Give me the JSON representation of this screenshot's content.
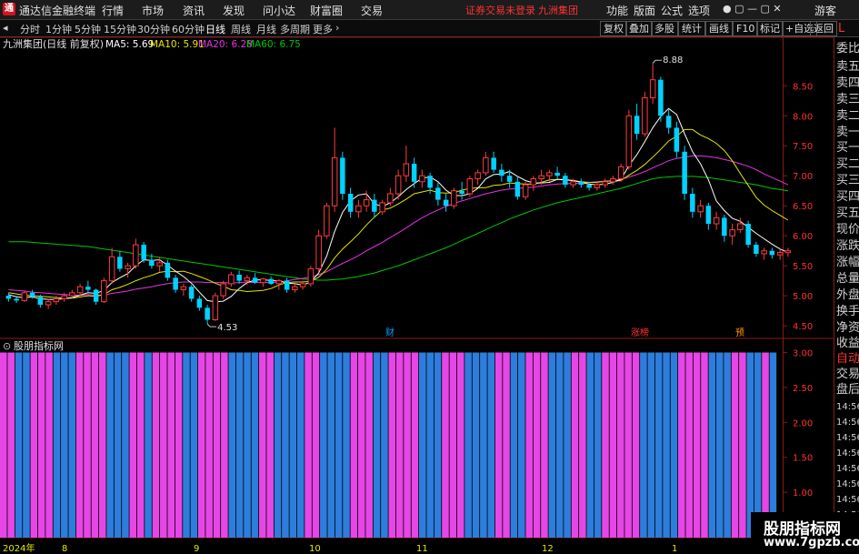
{
  "app": {
    "title": "通达信金融终端",
    "menu": [
      "行情",
      "市场",
      "资讯",
      "发现",
      "问小达",
      "财富圈",
      "交易"
    ],
    "notice": "证券交易未登录",
    "stock_name": "九洲集团",
    "right_menu": [
      "功能",
      "版面",
      "公式",
      "选项"
    ],
    "user": "游客"
  },
  "toolbar": {
    "periods": [
      "分时",
      "1分钟",
      "5分钟",
      "15分钟",
      "30分钟",
      "60分钟",
      "日线",
      "周线",
      "月线",
      "多周期",
      "更多"
    ],
    "active_period": "日线",
    "buttons": [
      "复权",
      "叠加",
      "多股",
      "统计",
      "画线",
      "F10",
      "标记",
      "+自选",
      "返回"
    ]
  },
  "chart_header": {
    "title": "九洲集团(日线 前复权)",
    "ma5": "MA5: 5.69",
    "ma10": "MA10: 5.91",
    "ma20": "MA20: 6.28",
    "ma60": "MA60: 6.75"
  },
  "colors": {
    "up": "#ff3c3c",
    "down": "#00d2ff",
    "ma5": "#ffffff",
    "ma10": "#e6e600",
    "ma20": "#e632e6",
    "ma60": "#00c800",
    "ind_a": "#e646e6",
    "ind_b": "#2d7ddc"
  },
  "price_axis": {
    "labels": [
      "8.50",
      "8.00",
      "7.50",
      "7.00",
      "6.50",
      "6.00",
      "5.50",
      "5.00",
      "4.50"
    ],
    "max_label": "8.88",
    "min_label": "4.53"
  },
  "event_markers": [
    "财",
    "涨榜",
    "预"
  ],
  "indicator": {
    "title": "股朋指标网",
    "axis_labels": [
      "3.00",
      "2.50",
      "2.00",
      "1.50",
      "1.00",
      "0.50"
    ]
  },
  "time_axis": [
    "2024年",
    "8",
    "9",
    "10",
    "11",
    "12",
    "1"
  ],
  "sidebar": {
    "labels": [
      "委比",
      "卖五",
      "卖四",
      "卖三",
      "卖二",
      "卖一",
      "买一",
      "买二",
      "买三",
      "买四",
      "买五",
      "现价",
      "涨跌",
      "涨幅",
      "总量",
      "外盘",
      "换手",
      "净资",
      "收益",
      "自动",
      "交易",
      "盘后"
    ],
    "times": [
      "14:56",
      "14:56",
      "14:56",
      "14:56",
      "14:56",
      "14:56",
      "14:56",
      "14:56"
    ],
    "corner": "L"
  },
  "watermark": {
    "line1": "股朋指标网",
    "line2": "www.7gpzb.com"
  },
  "chart_data": {
    "type": "candlestick",
    "ohlc": [
      [
        5.0,
        5.05,
        4.9,
        4.95
      ],
      [
        4.95,
        5.0,
        4.88,
        4.92
      ],
      [
        4.92,
        5.08,
        4.9,
        5.05
      ],
      [
        5.05,
        5.1,
        4.95,
        4.98
      ],
      [
        4.98,
        5.02,
        4.8,
        4.85
      ],
      [
        4.85,
        4.95,
        4.78,
        4.9
      ],
      [
        4.9,
        5.0,
        4.85,
        4.95
      ],
      [
        4.95,
        5.05,
        4.9,
        5.0
      ],
      [
        5.0,
        5.1,
        4.95,
        5.05
      ],
      [
        5.05,
        5.2,
        5.0,
        5.15
      ],
      [
        5.15,
        5.25,
        5.05,
        5.1
      ],
      [
        5.1,
        5.12,
        4.85,
        4.9
      ],
      [
        4.9,
        5.3,
        4.88,
        5.25
      ],
      [
        5.25,
        5.8,
        5.2,
        5.65
      ],
      [
        5.65,
        5.75,
        5.4,
        5.45
      ],
      [
        5.45,
        5.55,
        5.3,
        5.5
      ],
      [
        5.5,
        5.95,
        5.45,
        5.85
      ],
      [
        5.85,
        5.9,
        5.55,
        5.6
      ],
      [
        5.6,
        5.7,
        5.45,
        5.5
      ],
      [
        5.5,
        5.65,
        5.4,
        5.55
      ],
      [
        5.55,
        5.6,
        5.25,
        5.3
      ],
      [
        5.3,
        5.35,
        5.05,
        5.1
      ],
      [
        5.1,
        5.2,
        5.0,
        5.15
      ],
      [
        5.15,
        5.18,
        4.9,
        4.95
      ],
      [
        4.95,
        5.0,
        4.75,
        4.8
      ],
      [
        4.8,
        4.85,
        4.53,
        4.6
      ],
      [
        4.6,
        5.05,
        4.58,
        5.0
      ],
      [
        5.0,
        5.25,
        4.95,
        5.2
      ],
      [
        5.2,
        5.4,
        5.15,
        5.35
      ],
      [
        5.35,
        5.42,
        5.2,
        5.25
      ],
      [
        5.25,
        5.35,
        5.18,
        5.3
      ],
      [
        5.3,
        5.38,
        5.2,
        5.22
      ],
      [
        5.22,
        5.3,
        5.15,
        5.28
      ],
      [
        5.28,
        5.32,
        5.18,
        5.2
      ],
      [
        5.2,
        5.28,
        5.1,
        5.25
      ],
      [
        5.25,
        5.3,
        5.05,
        5.1
      ],
      [
        5.1,
        5.2,
        5.05,
        5.15
      ],
      [
        5.15,
        5.25,
        5.1,
        5.2
      ],
      [
        5.2,
        5.5,
        5.15,
        5.45
      ],
      [
        5.45,
        6.1,
        5.4,
        6.0
      ],
      [
        6.0,
        6.55,
        5.95,
        6.5
      ],
      [
        6.5,
        7.8,
        6.4,
        7.3
      ],
      [
        7.3,
        7.4,
        6.6,
        6.7
      ],
      [
        6.7,
        6.8,
        6.3,
        6.4
      ],
      [
        6.4,
        6.6,
        6.3,
        6.5
      ],
      [
        6.5,
        6.75,
        6.4,
        6.6
      ],
      [
        6.6,
        6.7,
        6.3,
        6.4
      ],
      [
        6.4,
        6.6,
        6.35,
        6.55
      ],
      [
        6.55,
        6.8,
        6.5,
        6.7
      ],
      [
        6.7,
        7.1,
        6.6,
        7.0
      ],
      [
        7.0,
        7.5,
        6.9,
        7.2
      ],
      [
        7.2,
        7.3,
        6.8,
        6.9
      ],
      [
        6.9,
        7.1,
        6.8,
        7.0
      ],
      [
        7.0,
        7.05,
        6.7,
        6.8
      ],
      [
        6.8,
        6.9,
        6.5,
        6.6
      ],
      [
        6.6,
        6.7,
        6.4,
        6.5
      ],
      [
        6.5,
        6.8,
        6.45,
        6.75
      ],
      [
        6.75,
        6.9,
        6.6,
        6.7
      ],
      [
        6.7,
        7.0,
        6.65,
        6.95
      ],
      [
        6.95,
        7.1,
        6.85,
        7.05
      ],
      [
        7.05,
        7.4,
        7.0,
        7.3
      ],
      [
        7.3,
        7.4,
        7.05,
        7.1
      ],
      [
        7.1,
        7.2,
        6.9,
        7.0
      ],
      [
        7.0,
        7.1,
        6.8,
        6.9
      ],
      [
        6.9,
        7.0,
        6.6,
        6.65
      ],
      [
        6.65,
        6.9,
        6.6,
        6.85
      ],
      [
        6.85,
        7.0,
        6.75,
        6.95
      ],
      [
        6.95,
        7.1,
        6.85,
        7.0
      ],
      [
        7.0,
        7.1,
        6.9,
        7.05
      ],
      [
        7.05,
        7.15,
        6.95,
        7.0
      ],
      [
        7.0,
        7.05,
        6.8,
        6.85
      ],
      [
        6.85,
        6.95,
        6.8,
        6.9
      ],
      [
        6.9,
        6.95,
        6.8,
        6.85
      ],
      [
        6.85,
        6.9,
        6.75,
        6.8
      ],
      [
        6.8,
        6.9,
        6.75,
        6.85
      ],
      [
        6.85,
        6.95,
        6.8,
        6.9
      ],
      [
        6.9,
        7.0,
        6.85,
        6.95
      ],
      [
        6.95,
        7.2,
        6.9,
        7.15
      ],
      [
        7.15,
        8.1,
        7.1,
        8.0
      ],
      [
        8.0,
        8.2,
        7.6,
        7.7
      ],
      [
        7.7,
        8.4,
        7.65,
        8.3
      ],
      [
        8.3,
        8.88,
        8.2,
        8.6
      ],
      [
        8.6,
        8.65,
        7.9,
        8.0
      ],
      [
        8.0,
        8.1,
        7.7,
        7.8
      ],
      [
        7.8,
        7.9,
        7.3,
        7.4
      ],
      [
        7.4,
        7.5,
        6.6,
        6.7
      ],
      [
        6.7,
        6.8,
        6.3,
        6.4
      ],
      [
        6.4,
        6.6,
        6.3,
        6.5
      ],
      [
        6.5,
        6.55,
        6.1,
        6.2
      ],
      [
        6.2,
        6.4,
        6.1,
        6.3
      ],
      [
        6.3,
        6.35,
        5.9,
        6.0
      ],
      [
        6.0,
        6.2,
        5.85,
        6.1
      ],
      [
        6.1,
        6.3,
        6.05,
        6.2
      ],
      [
        6.2,
        6.25,
        5.8,
        5.85
      ],
      [
        5.85,
        5.9,
        5.65,
        5.7
      ],
      [
        5.7,
        5.8,
        5.6,
        5.75
      ],
      [
        5.75,
        5.8,
        5.62,
        5.68
      ],
      [
        5.68,
        5.78,
        5.6,
        5.72
      ],
      [
        5.72,
        5.8,
        5.65,
        5.75
      ]
    ],
    "ma5": [
      5.02,
      4.98,
      4.97,
      4.98,
      4.95,
      4.94,
      4.94,
      4.95,
      4.97,
      5.01,
      5.05,
      5.04,
      5.09,
      5.22,
      5.3,
      5.37,
      5.5,
      5.6,
      5.59,
      5.6,
      5.51,
      5.41,
      5.32,
      5.21,
      5.06,
      4.92,
      4.9,
      4.91,
      4.99,
      5.12,
      5.22,
      5.26,
      5.27,
      5.25,
      5.25,
      5.21,
      5.2,
      5.18,
      5.23,
      5.38,
      5.66,
      6.07,
      6.39,
      6.58,
      6.68,
      6.7,
      6.53,
      6.49,
      6.55,
      6.65,
      6.77,
      6.87,
      6.96,
      6.98,
      6.9,
      6.76,
      6.67,
      6.67,
      6.7,
      6.79,
      6.95,
      7.02,
      7.03,
      7.07,
      6.99,
      6.92,
      6.88,
      6.88,
      6.89,
      6.94,
      6.93,
      6.92,
      6.89,
      6.86,
      6.85,
      6.86,
      6.89,
      6.94,
      7.17,
      7.35,
      7.57,
      7.8,
      7.99,
      8.12,
      8.02,
      7.7,
      7.4,
      7.2,
      6.93,
      6.58,
      6.42,
      6.29,
      6.24,
      6.14,
      6.04,
      5.95,
      5.86,
      5.78,
      5.72
    ],
    "ma10": [
      5.05,
      5.03,
      5.01,
      5.0,
      4.99,
      4.98,
      4.97,
      4.96,
      4.96,
      4.98,
      5.0,
      4.99,
      5.02,
      5.1,
      5.14,
      5.19,
      5.25,
      5.3,
      5.34,
      5.39,
      5.41,
      5.4,
      5.41,
      5.37,
      5.32,
      5.27,
      5.21,
      5.16,
      5.1,
      5.09,
      5.07,
      5.08,
      5.09,
      5.12,
      5.18,
      5.22,
      5.23,
      5.23,
      5.24,
      5.31,
      5.44,
      5.63,
      5.78,
      5.9,
      6.03,
      6.18,
      6.31,
      6.43,
      6.46,
      6.53,
      6.61,
      6.7,
      6.73,
      6.76,
      6.72,
      6.71,
      6.72,
      6.76,
      6.79,
      6.8,
      6.8,
      6.84,
      6.85,
      6.88,
      6.87,
      6.86,
      6.86,
      6.89,
      6.93,
      6.94,
      6.94,
      6.92,
      6.9,
      6.89,
      6.89,
      6.91,
      6.91,
      6.92,
      7.01,
      7.09,
      7.19,
      7.31,
      7.44,
      7.58,
      7.66,
      7.77,
      7.77,
      7.68,
      7.62,
      7.54,
      7.42,
      7.25,
      7.04,
      6.84,
      6.64,
      6.51,
      6.42,
      6.34,
      6.26
    ],
    "ma20": [
      5.1,
      5.09,
      5.08,
      5.06,
      5.05,
      5.04,
      5.03,
      5.02,
      5.01,
      5.01,
      5.02,
      5.01,
      5.01,
      5.04,
      5.06,
      5.08,
      5.11,
      5.13,
      5.15,
      5.18,
      5.2,
      5.22,
      5.23,
      5.23,
      5.23,
      5.22,
      5.22,
      5.22,
      5.21,
      5.22,
      5.23,
      5.22,
      5.22,
      5.22,
      5.23,
      5.25,
      5.27,
      5.29,
      5.31,
      5.35,
      5.4,
      5.47,
      5.54,
      5.6,
      5.67,
      5.75,
      5.82,
      5.89,
      5.97,
      6.05,
      6.13,
      6.22,
      6.3,
      6.37,
      6.43,
      6.49,
      6.54,
      6.58,
      6.62,
      6.66,
      6.7,
      6.73,
      6.76,
      6.78,
      6.79,
      6.8,
      6.81,
      6.83,
      6.85,
      6.86,
      6.87,
      6.87,
      6.88,
      6.89,
      6.9,
      6.91,
      6.92,
      6.94,
      6.98,
      7.02,
      7.07,
      7.13,
      7.19,
      7.25,
      7.29,
      7.31,
      7.33,
      7.33,
      7.32,
      7.3,
      7.27,
      7.24,
      7.2,
      7.16,
      7.1,
      7.03,
      6.97,
      6.91,
      6.85
    ],
    "ma60": [
      5.9,
      5.9,
      5.9,
      5.89,
      5.88,
      5.87,
      5.86,
      5.85,
      5.84,
      5.83,
      5.82,
      5.8,
      5.78,
      5.76,
      5.74,
      5.72,
      5.7,
      5.68,
      5.66,
      5.64,
      5.62,
      5.6,
      5.58,
      5.56,
      5.54,
      5.52,
      5.5,
      5.48,
      5.46,
      5.44,
      5.42,
      5.4,
      5.38,
      5.36,
      5.34,
      5.32,
      5.3,
      5.28,
      5.27,
      5.26,
      5.26,
      5.27,
      5.28,
      5.3,
      5.32,
      5.35,
      5.38,
      5.42,
      5.46,
      5.5,
      5.55,
      5.6,
      5.65,
      5.7,
      5.75,
      5.8,
      5.86,
      5.92,
      5.98,
      6.04,
      6.1,
      6.16,
      6.22,
      6.28,
      6.33,
      6.38,
      6.43,
      6.47,
      6.51,
      6.55,
      6.58,
      6.61,
      6.64,
      6.67,
      6.7,
      6.73,
      6.76,
      6.79,
      6.83,
      6.87,
      6.91,
      6.95,
      6.97,
      6.98,
      6.99,
      6.99,
      6.99,
      6.98,
      6.97,
      6.95,
      6.93,
      6.91,
      6.89,
      6.87,
      6.85,
      6.82,
      6.79,
      6.77,
      6.75
    ],
    "indicator_pattern": [
      1,
      1,
      0,
      0,
      1,
      1,
      1,
      0,
      0,
      0,
      1,
      1,
      1,
      1,
      0,
      0,
      0,
      1,
      1,
      0,
      1,
      1,
      1,
      1,
      0,
      0,
      1,
      1,
      1,
      1,
      0,
      0,
      0,
      0,
      1,
      1,
      0,
      0,
      0,
      0,
      1,
      1,
      0,
      0,
      0,
      0,
      1,
      1,
      1,
      0,
      0,
      1,
      1,
      1,
      1,
      0,
      0,
      0,
      1,
      1,
      1,
      0,
      0,
      0,
      0,
      1,
      1,
      0,
      0,
      1,
      1,
      1,
      0,
      0,
      0,
      1,
      1,
      0,
      0,
      1,
      1,
      1,
      1,
      1,
      0,
      0,
      0,
      0,
      0,
      1,
      1,
      1,
      1,
      0,
      0,
      0,
      1,
      1,
      0,
      0,
      1,
      0
    ],
    "ylim": [
      4.35,
      9.05
    ],
    "indicator_ylim": [
      0.35,
      3.15
    ],
    "indicator_value": 3.0
  }
}
